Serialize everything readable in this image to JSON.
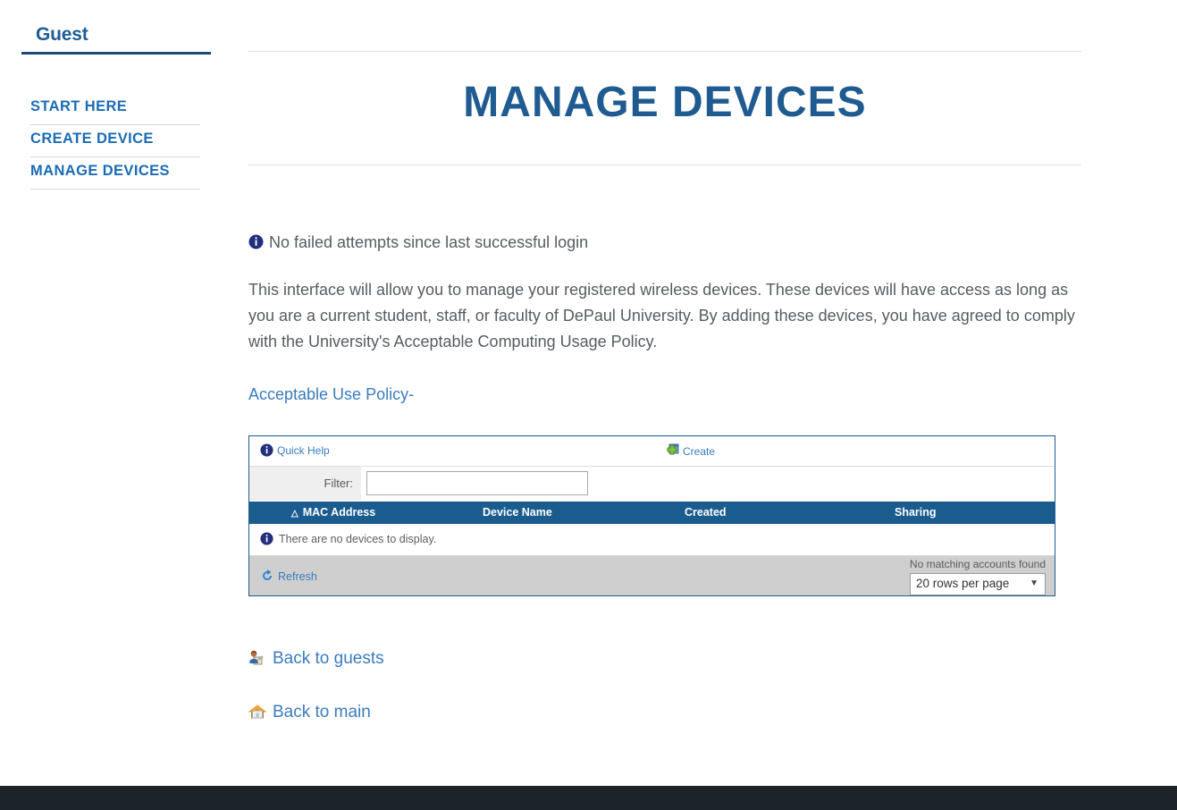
{
  "sidebar": {
    "account_label": "Guest",
    "items": [
      {
        "label": "START HERE",
        "icon": "nav-link"
      },
      {
        "label": "CREATE DEVICE",
        "icon": "nav-link"
      },
      {
        "label": "MANAGE DEVICES",
        "icon": "nav-link"
      }
    ]
  },
  "main": {
    "title": "MANAGE DEVICES",
    "notice": "No failed attempts since last successful login",
    "notice_icon": "info-icon",
    "intro": "This interface will allow you to manage your registered wireless devices. These devices will have access as long as you are a current student, staff, or faculty of DePaul University. By adding these devices, you have agreed to comply with the University's Acceptable Computing Usage Policy.",
    "policy_link": "Acceptable Use Policy-"
  },
  "panel": {
    "quick_help": "Quick Help",
    "quick_help_icon": "info-icon",
    "create": "Create",
    "create_icon": "add-window-icon",
    "filter_label": "Filter:",
    "filter_value": "",
    "filter_placeholder": "",
    "columns": [
      {
        "label": "MAC Address",
        "sort": "ascending",
        "sort_icon": "sort-ascending-triangle-icon"
      },
      {
        "label": "Device Name",
        "sort": "none"
      },
      {
        "label": "Created",
        "sort": "none"
      },
      {
        "label": "Sharing",
        "sort": "none"
      }
    ],
    "rows": [],
    "empty_message": "There are no devices to display.",
    "empty_icon": "info-icon",
    "refresh": "Refresh",
    "refresh_icon": "refresh-icon",
    "match_status": "No matching accounts found",
    "rows_per_page": "20 rows per page",
    "rows_per_page_options": [
      "20 rows per page"
    ],
    "dropdown_icon": "chevron-down-icon"
  },
  "bottom_links": [
    {
      "label": "Back to guests",
      "icon": "user-guest-icon"
    },
    {
      "label": "Back to main",
      "icon": "home-icon"
    }
  ],
  "colors": {
    "brand_blue": "#1f5b90",
    "link_blue": "#3a7cbd",
    "nav_blue": "#1b6cb5",
    "table_header": "#1b5c8e",
    "footer_dark": "#1c2429",
    "panel_footer_gray": "#cfcfcf"
  }
}
